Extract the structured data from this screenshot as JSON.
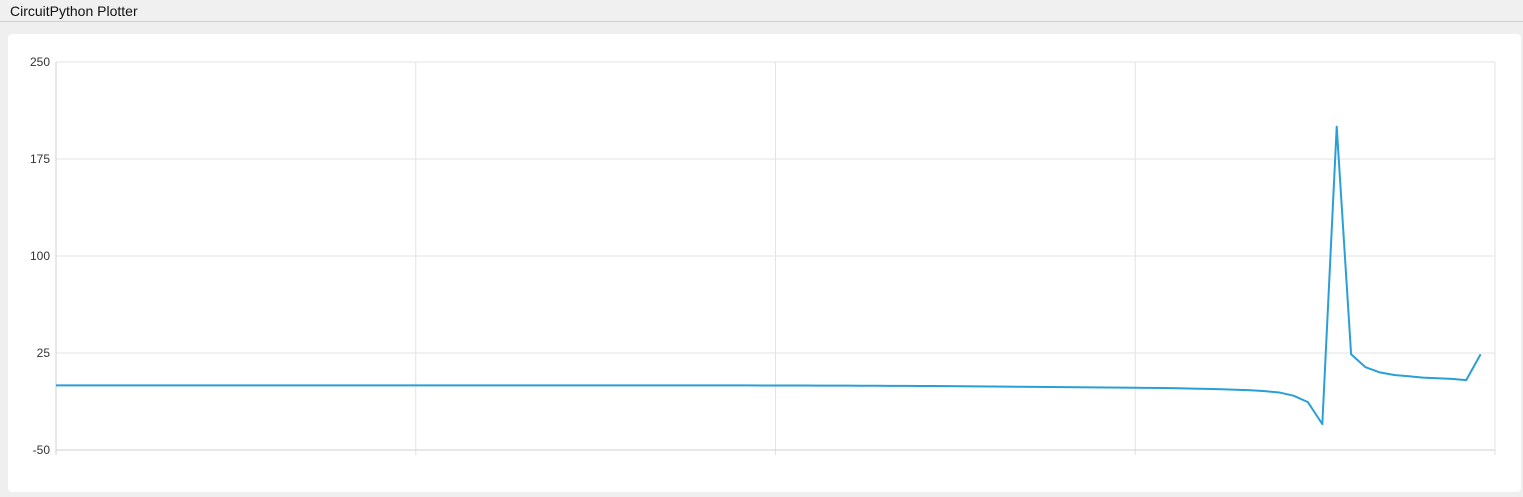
{
  "window": {
    "title": "CircuitPython Plotter"
  },
  "chart_data": {
    "type": "line",
    "title": "",
    "xlabel": "",
    "ylabel": "",
    "ylim": [
      -50,
      250
    ],
    "xlim": [
      0,
      100
    ],
    "yticks": [
      250,
      175,
      100,
      25,
      -50
    ],
    "xgrid_divisions": 4,
    "grid": true,
    "legend": "none",
    "series": [
      {
        "color": "#2a9fd6",
        "x": [
          0,
          1,
          2,
          3,
          4,
          5,
          6,
          7,
          8,
          9,
          10,
          11,
          12,
          13,
          14,
          15,
          16,
          17,
          18,
          19,
          20,
          21,
          22,
          23,
          24,
          25,
          26,
          27,
          28,
          29,
          30,
          31,
          32,
          33,
          34,
          35,
          36,
          37,
          38,
          39,
          40,
          41,
          42,
          43,
          44,
          45,
          46,
          47,
          48,
          49,
          50,
          51,
          52,
          53,
          54,
          55,
          56,
          57,
          58,
          59,
          60,
          61,
          62,
          63,
          64,
          65,
          66,
          67,
          68,
          69,
          70,
          71,
          72,
          73,
          74,
          75,
          76,
          77,
          78,
          79,
          80,
          81,
          82,
          83,
          84,
          85,
          86,
          87,
          88,
          89,
          90,
          91,
          92,
          93,
          94,
          95,
          96,
          97,
          98,
          99
        ],
        "values": [
          0,
          0,
          0,
          0,
          0,
          0,
          0,
          0,
          0,
          0,
          0,
          0,
          0,
          0,
          0,
          0,
          0,
          0,
          0,
          0,
          0,
          0,
          0,
          0,
          0,
          0,
          0,
          0,
          0,
          0,
          0,
          0,
          0,
          0,
          0,
          0,
          0,
          0,
          0,
          0,
          0,
          0,
          0,
          0,
          0,
          0,
          0,
          0,
          0,
          -0.1,
          -0.1,
          -0.1,
          -0.1,
          -0.2,
          -0.2,
          -0.2,
          -0.3,
          -0.3,
          -0.4,
          -0.4,
          -0.5,
          -0.5,
          -0.6,
          -0.7,
          -0.8,
          -0.9,
          -1.0,
          -1.1,
          -1.2,
          -1.3,
          -1.4,
          -1.5,
          -1.6,
          -1.7,
          -1.8,
          -1.9,
          -2.0,
          -2.1,
          -2.3,
          -2.5,
          -2.7,
          -3.0,
          -3.4,
          -3.8,
          -4.5,
          -5.5,
          -8,
          -13,
          -30,
          200,
          24,
          14,
          10,
          8,
          7,
          6,
          5.5,
          5,
          4,
          24
        ]
      }
    ]
  }
}
